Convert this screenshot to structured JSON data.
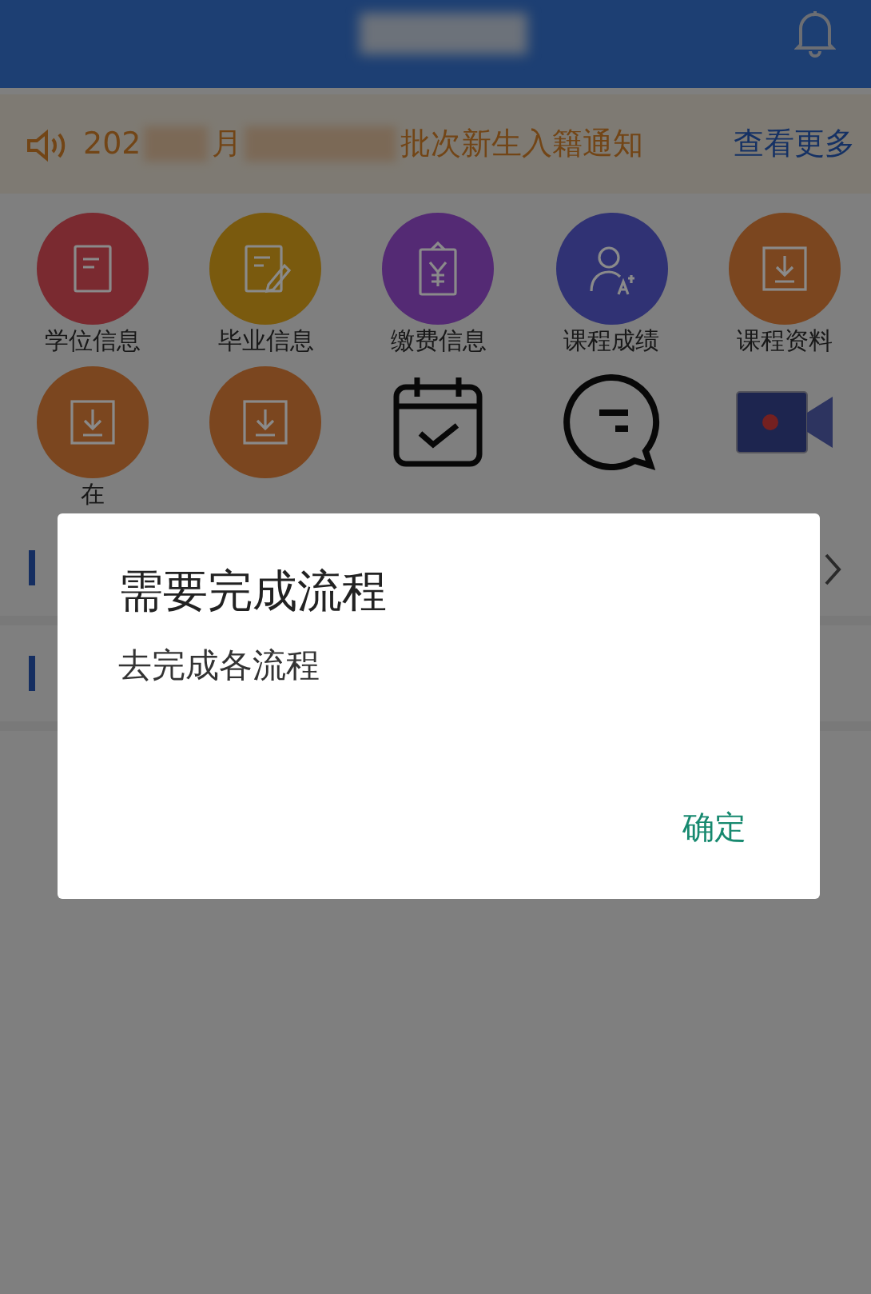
{
  "notice": {
    "parts": [
      "202",
      "月",
      "批次新生入籍通知"
    ],
    "more": "查看更多"
  },
  "apps": [
    {
      "label": "学位信息",
      "kind": "doc",
      "color": "#7a2a30"
    },
    {
      "label": "毕业信息",
      "kind": "edit",
      "color": "#7a5a0e"
    },
    {
      "label": "缴费信息",
      "kind": "payment",
      "color": "#542a74"
    },
    {
      "label": "课程成绩",
      "kind": "grade",
      "color": "#303274"
    },
    {
      "label": "课程资料",
      "kind": "download",
      "color": "#7b461f"
    },
    {
      "label": "在",
      "kind": "download",
      "color": "#7b461f"
    },
    {
      "kind": "download",
      "color": "#7b461f"
    },
    {
      "kind": "calendar"
    },
    {
      "kind": "chat"
    },
    {
      "kind": "video"
    }
  ],
  "dialog": {
    "title": "需要完成流程",
    "message": "去完成各流程",
    "button": "确定"
  }
}
